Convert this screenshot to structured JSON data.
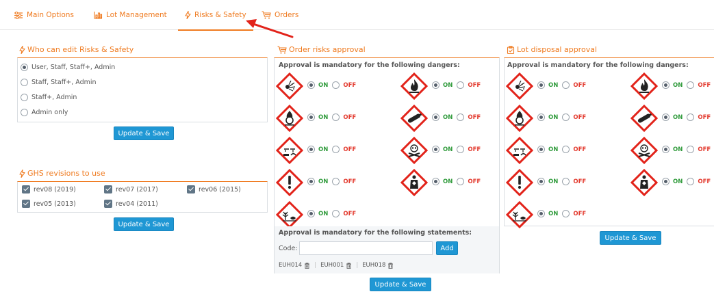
{
  "tabs": [
    {
      "label": "Main Options",
      "icon": "sliders-icon"
    },
    {
      "label": "Lot Management",
      "icon": "chart-icon"
    },
    {
      "label": "Risks & Safety",
      "icon": "bolt-icon"
    },
    {
      "label": "Orders",
      "icon": "cart-icon"
    }
  ],
  "active_tab": "Risks & Safety",
  "colors": {
    "accent": "#ef7a1f",
    "button": "#1f97d4",
    "on": "#2e9a3a",
    "off": "#e33b2f",
    "pictogram": "#e2231a"
  },
  "who_can_edit": {
    "title": "Who can edit Risks & Safety",
    "options": [
      "User, Staff, Staff+, Admin",
      "Staff, Staff+, Admin",
      "Staff+, Admin",
      "Admin only"
    ],
    "selected": "User, Staff, Staff+, Admin",
    "button": "Update & Save"
  },
  "ghs_revisions": {
    "title": "GHS revisions to use",
    "items": [
      {
        "label": "rev08 (2019)",
        "checked": true
      },
      {
        "label": "rev07 (2017)",
        "checked": true
      },
      {
        "label": "rev06 (2015)",
        "checked": true
      },
      {
        "label": "rev05 (2013)",
        "checked": true
      },
      {
        "label": "rev04 (2011)",
        "checked": true
      }
    ],
    "button": "Update & Save"
  },
  "order_risks": {
    "title": "Order risks approval",
    "dangers_header": "Approval is mandatory for the following dangers:",
    "pictograms": [
      {
        "icon": "explosive-icon",
        "state": "ON"
      },
      {
        "icon": "flammable-icon",
        "state": "ON"
      },
      {
        "icon": "oxidizer-icon",
        "state": "ON"
      },
      {
        "icon": "gas-cylinder-icon",
        "state": "ON"
      },
      {
        "icon": "corrosive-icon",
        "state": "ON"
      },
      {
        "icon": "toxic-skull-icon",
        "state": "ON"
      },
      {
        "icon": "exclamation-icon",
        "state": "ON"
      },
      {
        "icon": "health-hazard-icon",
        "state": "ON"
      },
      {
        "icon": "environment-icon",
        "state": "ON"
      }
    ],
    "on_label": "ON",
    "off_label": "OFF",
    "statements_header": "Approval is mandatory for the following statements:",
    "code_label": "Code:",
    "code_value": "",
    "add_button": "Add",
    "statements": [
      "EUH014",
      "EUH001",
      "EUH018"
    ],
    "button": "Update & Save"
  },
  "lot_disposal": {
    "title": "Lot disposal approval",
    "dangers_header": "Approval is mandatory for the following dangers:",
    "pictograms": [
      {
        "icon": "explosive-icon",
        "state": "ON"
      },
      {
        "icon": "flammable-icon",
        "state": "ON"
      },
      {
        "icon": "oxidizer-icon",
        "state": "ON"
      },
      {
        "icon": "gas-cylinder-icon",
        "state": "ON"
      },
      {
        "icon": "corrosive-icon",
        "state": "ON"
      },
      {
        "icon": "toxic-skull-icon",
        "state": "ON"
      },
      {
        "icon": "exclamation-icon",
        "state": "ON"
      },
      {
        "icon": "health-hazard-icon",
        "state": "ON"
      },
      {
        "icon": "environment-icon",
        "state": "ON"
      }
    ],
    "on_label": "ON",
    "off_label": "OFF",
    "button": "Update & Save"
  }
}
